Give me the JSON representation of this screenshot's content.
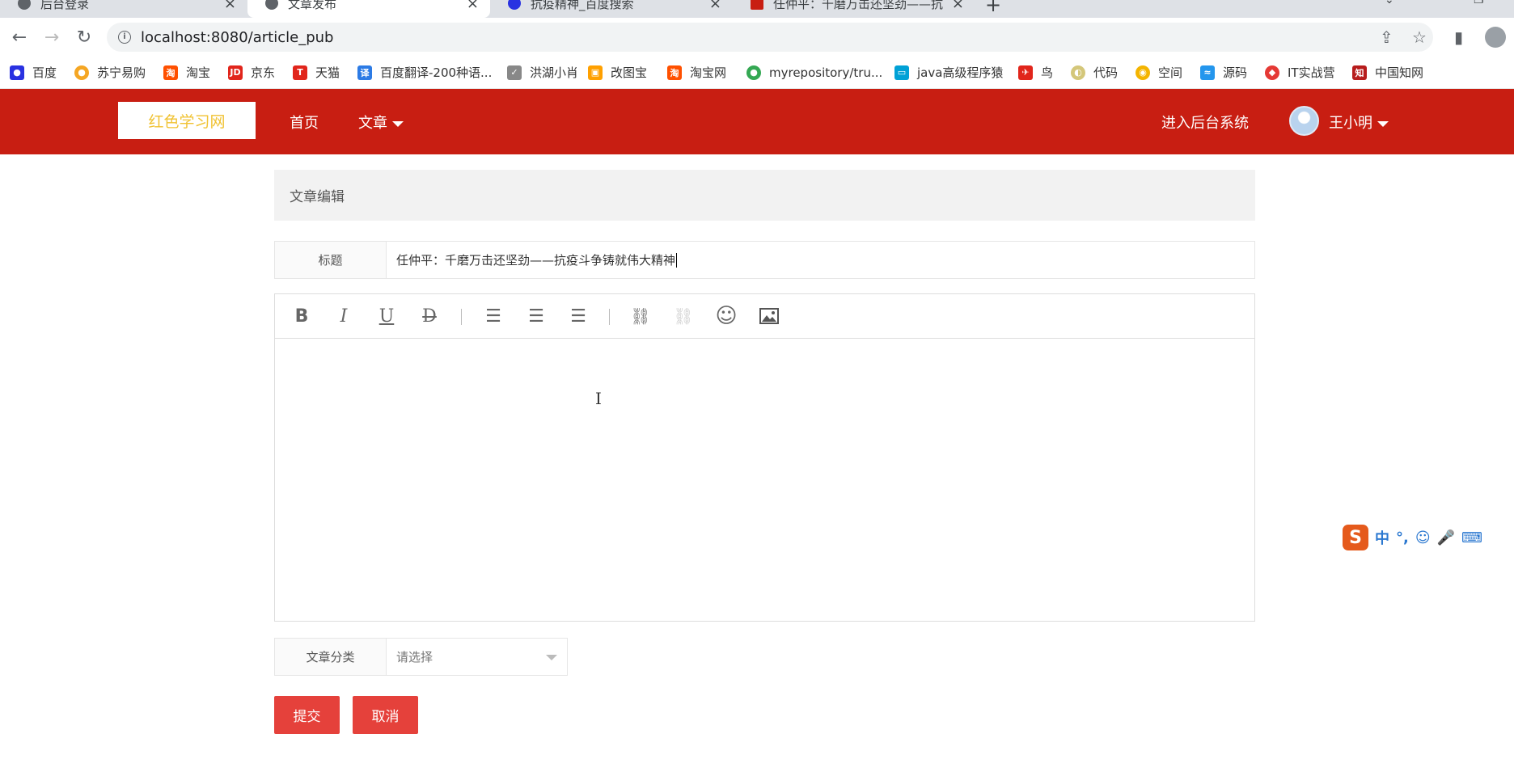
{
  "browser": {
    "tabs": [
      {
        "title": "后台登录",
        "active": false
      },
      {
        "title": "文章发布",
        "active": true
      },
      {
        "title": "抗疫精神_百度搜索",
        "active": false
      },
      {
        "title": "任仲平：千磨万击还坚劲——抗",
        "active": false
      }
    ],
    "url": "localhost:8080/article_pub",
    "bookmarks": [
      {
        "label": "百度",
        "icon": "baidu-icon",
        "color": "#2932e1"
      },
      {
        "label": "苏宁易购",
        "icon": "suning-icon",
        "color": "#f5a623"
      },
      {
        "label": "淘宝",
        "icon": "taobao-icon",
        "color": "#ff5000"
      },
      {
        "label": "京东",
        "icon": "jd-icon",
        "color": "#e1251b"
      },
      {
        "label": "天猫",
        "icon": "tmall-icon",
        "color": "#e1251b"
      },
      {
        "label": "百度翻译-200种语...",
        "icon": "translate-icon",
        "color": "#2c7be5"
      },
      {
        "label": "洪湖小肖",
        "icon": "bird-icon",
        "color": "#888888"
      },
      {
        "label": "改图宝",
        "icon": "image-tool-icon",
        "color": "#ffa000"
      },
      {
        "label": "淘宝网",
        "icon": "taobao-icon",
        "color": "#ff5000"
      },
      {
        "label": "myrepository/tru...",
        "icon": "chrome-icon",
        "color": "#34a853"
      },
      {
        "label": "java高级程序猿",
        "icon": "bilibili-icon",
        "color": "#00a1d6"
      },
      {
        "label": "鸟",
        "icon": "bird-icon",
        "color": "#e1251b"
      },
      {
        "label": "代码",
        "icon": "code-icon",
        "color": "#d4c77a"
      },
      {
        "label": "空间",
        "icon": "qzone-icon",
        "color": "#f4b400"
      },
      {
        "label": "源码",
        "icon": "docker-icon",
        "color": "#2496ed"
      },
      {
        "label": "IT实战营",
        "icon": "it-icon",
        "color": "#e53935"
      },
      {
        "label": "中国知网",
        "icon": "cnki-icon",
        "color": "#b71c1c"
      }
    ]
  },
  "header": {
    "logo": "红色学习网",
    "nav": {
      "home": "首页",
      "article": "文章"
    },
    "admin_link": "进入后台系统",
    "username": "王小明",
    "brand_color": "#c81e12",
    "logo_color": "#f0c232"
  },
  "editor": {
    "panel_title": "文章编辑",
    "title_label": "标题",
    "title_value": "任仲平：千磨万击还坚劲——抗疫斗争铸就伟大精神",
    "toolbar": [
      {
        "name": "bold-icon",
        "glyph": "B"
      },
      {
        "name": "italic-icon",
        "glyph": "I"
      },
      {
        "name": "underline-icon",
        "glyph": "U"
      },
      {
        "name": "strikethrough-icon",
        "glyph": "D"
      },
      {
        "name": "align-left-icon",
        "glyph": "≡"
      },
      {
        "name": "align-center-icon",
        "glyph": "≡"
      },
      {
        "name": "align-right-icon",
        "glyph": "≡"
      },
      {
        "name": "link-icon",
        "glyph": "🔗"
      },
      {
        "name": "unlink-icon",
        "glyph": "⛓"
      },
      {
        "name": "emoji-icon",
        "glyph": "☺"
      },
      {
        "name": "image-icon",
        "glyph": "🖼"
      }
    ],
    "category_label": "文章分类",
    "category_placeholder": "请选择",
    "submit_label": "提交",
    "cancel_label": "取消",
    "button_color": "#e5413b"
  },
  "ime": {
    "logo": "S",
    "mode": "中"
  }
}
